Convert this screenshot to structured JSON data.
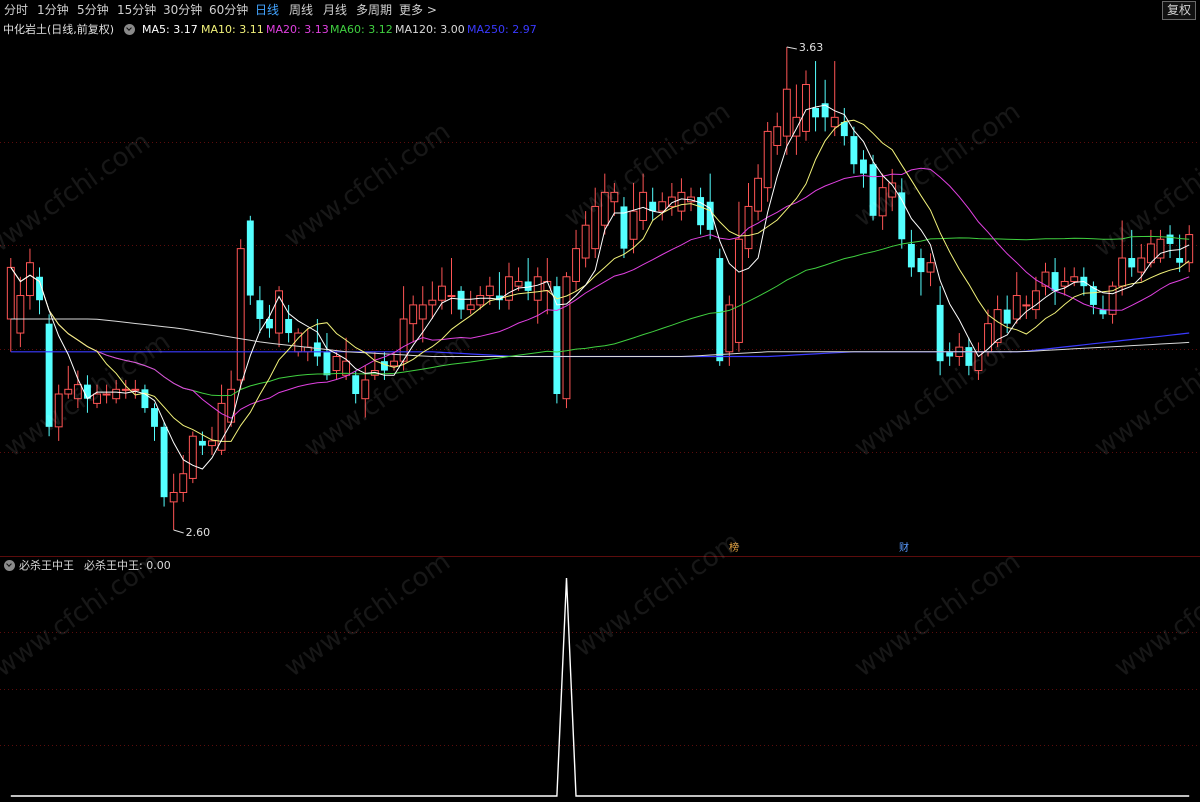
{
  "toolbar": {
    "tabs": [
      "分时",
      "1分钟",
      "5分钟",
      "15分钟",
      "30分钟",
      "60分钟",
      "日线",
      "周线",
      "月线",
      "多周期",
      "更多 >"
    ],
    "active_tab": "日线",
    "fq_label": "复权"
  },
  "stock": {
    "title": "中化岩土(日线,前复权)"
  },
  "ma_legend": [
    {
      "label": "MA5: 3.17",
      "color": "#ffffff"
    },
    {
      "label": "MA10: 3.11",
      "color": "#f2f27a"
    },
    {
      "label": "MA20: 3.13",
      "color": "#e040e0"
    },
    {
      "label": "MA60: 3.12",
      "color": "#40d040"
    },
    {
      "label": "MA120: 3.00",
      "color": "#d8d8d8"
    },
    {
      "label": "MA250: 2.97",
      "color": "#3a3aff"
    }
  ],
  "annotations": {
    "high_label": "3.63",
    "low_label": "2.60"
  },
  "badges": [
    {
      "text": "榜",
      "color": "#e0a040"
    },
    {
      "text": "财",
      "color": "#5a9aff"
    }
  ],
  "indicator": {
    "name": "必杀王中王",
    "value_label": "必杀王中王: 0.00"
  },
  "watermark_text": "www.cfchi.com",
  "colors": {
    "up": "#ff5555",
    "down": "#54ffff",
    "grid": "#5c0c0c",
    "active_tab": "#43a4ff"
  },
  "chart_data": {
    "type": "candlestick",
    "price_range": [
      2.6,
      3.63
    ],
    "candles": [
      {
        "o": 3.05,
        "c": 3.16,
        "h": 3.18,
        "l": 2.98
      },
      {
        "o": 3.02,
        "c": 3.1,
        "h": 3.14,
        "l": 2.99
      },
      {
        "o": 3.1,
        "c": 3.17,
        "h": 3.2,
        "l": 3.07
      },
      {
        "o": 3.14,
        "c": 3.09,
        "h": 3.16,
        "l": 3.06
      },
      {
        "o": 3.04,
        "c": 2.82,
        "h": 3.06,
        "l": 2.8
      },
      {
        "o": 2.82,
        "c": 2.89,
        "h": 2.91,
        "l": 2.79
      },
      {
        "o": 2.89,
        "c": 2.9,
        "h": 2.95,
        "l": 2.88
      },
      {
        "o": 2.88,
        "c": 2.91,
        "h": 2.94,
        "l": 2.86
      },
      {
        "o": 2.91,
        "c": 2.88,
        "h": 2.93,
        "l": 2.85
      },
      {
        "o": 2.87,
        "c": 2.89,
        "h": 2.91,
        "l": 2.86
      },
      {
        "o": 2.89,
        "c": 2.89,
        "h": 2.91,
        "l": 2.87
      },
      {
        "o": 2.88,
        "c": 2.9,
        "h": 2.92,
        "l": 2.87
      },
      {
        "o": 2.9,
        "c": 2.9,
        "h": 2.92,
        "l": 2.88
      },
      {
        "o": 2.9,
        "c": 2.9,
        "h": 2.92,
        "l": 2.88
      },
      {
        "o": 2.9,
        "c": 2.86,
        "h": 2.91,
        "l": 2.85
      },
      {
        "o": 2.86,
        "c": 2.82,
        "h": 2.87,
        "l": 2.79
      },
      {
        "o": 2.82,
        "c": 2.67,
        "h": 2.83,
        "l": 2.65
      },
      {
        "o": 2.66,
        "c": 2.68,
        "h": 2.72,
        "l": 2.6
      },
      {
        "o": 2.68,
        "c": 2.72,
        "h": 2.76,
        "l": 2.66
      },
      {
        "o": 2.71,
        "c": 2.8,
        "h": 2.81,
        "l": 2.7
      },
      {
        "o": 2.79,
        "c": 2.78,
        "h": 2.81,
        "l": 2.76
      },
      {
        "o": 2.78,
        "c": 2.79,
        "h": 2.82,
        "l": 2.76
      },
      {
        "o": 2.77,
        "c": 2.87,
        "h": 2.91,
        "l": 2.76
      },
      {
        "o": 2.83,
        "c": 2.9,
        "h": 2.94,
        "l": 2.82
      },
      {
        "o": 2.92,
        "c": 3.2,
        "h": 3.22,
        "l": 2.9
      },
      {
        "o": 3.26,
        "c": 3.1,
        "h": 3.27,
        "l": 3.08
      },
      {
        "o": 3.09,
        "c": 3.05,
        "h": 3.12,
        "l": 3.02
      },
      {
        "o": 3.05,
        "c": 3.03,
        "h": 3.08,
        "l": 3.01
      },
      {
        "o": 3.02,
        "c": 3.11,
        "h": 3.12,
        "l": 2.99
      },
      {
        "o": 3.05,
        "c": 3.02,
        "h": 3.08,
        "l": 3.0
      },
      {
        "o": 2.98,
        "c": 3.02,
        "h": 3.03,
        "l": 2.97
      },
      {
        "o": 2.98,
        "c": 2.99,
        "h": 3.03,
        "l": 2.96
      },
      {
        "o": 3.0,
        "c": 2.97,
        "h": 3.05,
        "l": 2.95
      },
      {
        "o": 2.98,
        "c": 2.93,
        "h": 3.02,
        "l": 2.92
      },
      {
        "o": 2.94,
        "c": 2.97,
        "h": 2.98,
        "l": 2.92
      },
      {
        "o": 2.93,
        "c": 2.96,
        "h": 3.01,
        "l": 2.92
      },
      {
        "o": 2.93,
        "c": 2.89,
        "h": 2.94,
        "l": 2.87
      },
      {
        "o": 2.88,
        "c": 2.92,
        "h": 2.95,
        "l": 2.84
      },
      {
        "o": 2.93,
        "c": 2.94,
        "h": 2.98,
        "l": 2.92
      },
      {
        "o": 2.96,
        "c": 2.94,
        "h": 2.98,
        "l": 2.92
      },
      {
        "o": 2.95,
        "c": 2.96,
        "h": 2.98,
        "l": 2.94
      },
      {
        "o": 2.96,
        "c": 3.05,
        "h": 3.12,
        "l": 2.94
      },
      {
        "o": 3.04,
        "c": 3.08,
        "h": 3.1,
        "l": 3.0
      },
      {
        "o": 3.05,
        "c": 3.08,
        "h": 3.12,
        "l": 3.0
      },
      {
        "o": 3.08,
        "c": 3.09,
        "h": 3.13,
        "l": 3.05
      },
      {
        "o": 3.09,
        "c": 3.12,
        "h": 3.16,
        "l": 3.07
      },
      {
        "o": 3.1,
        "c": 3.1,
        "h": 3.18,
        "l": 3.06
      },
      {
        "o": 3.11,
        "c": 3.07,
        "h": 3.12,
        "l": 3.05
      },
      {
        "o": 3.07,
        "c": 3.08,
        "h": 3.11,
        "l": 3.06
      },
      {
        "o": 3.08,
        "c": 3.1,
        "h": 3.12,
        "l": 3.07
      },
      {
        "o": 3.1,
        "c": 3.12,
        "h": 3.14,
        "l": 3.08
      },
      {
        "o": 3.1,
        "c": 3.09,
        "h": 3.15,
        "l": 3.07
      },
      {
        "o": 3.09,
        "c": 3.14,
        "h": 3.17,
        "l": 3.07
      },
      {
        "o": 3.12,
        "c": 3.13,
        "h": 3.16,
        "l": 3.11
      },
      {
        "o": 3.13,
        "c": 3.11,
        "h": 3.18,
        "l": 3.09
      },
      {
        "o": 3.09,
        "c": 3.14,
        "h": 3.16,
        "l": 3.04
      },
      {
        "o": 3.11,
        "c": 3.13,
        "h": 3.18,
        "l": 3.06
      },
      {
        "o": 3.12,
        "c": 2.89,
        "h": 3.14,
        "l": 2.87
      },
      {
        "o": 2.88,
        "c": 3.14,
        "h": 3.15,
        "l": 2.86
      },
      {
        "o": 3.13,
        "c": 3.2,
        "h": 3.24,
        "l": 3.11
      },
      {
        "o": 3.18,
        "c": 3.25,
        "h": 3.28,
        "l": 3.16
      },
      {
        "o": 3.2,
        "c": 3.29,
        "h": 3.33,
        "l": 3.18
      },
      {
        "o": 3.25,
        "c": 3.32,
        "h": 3.36,
        "l": 3.23
      },
      {
        "o": 3.3,
        "c": 3.32,
        "h": 3.34,
        "l": 3.27
      },
      {
        "o": 3.29,
        "c": 3.2,
        "h": 3.31,
        "l": 3.18
      },
      {
        "o": 3.22,
        "c": 3.28,
        "h": 3.34,
        "l": 3.19
      },
      {
        "o": 3.26,
        "c": 3.32,
        "h": 3.36,
        "l": 3.24
      },
      {
        "o": 3.3,
        "c": 3.28,
        "h": 3.33,
        "l": 3.26
      },
      {
        "o": 3.28,
        "c": 3.3,
        "h": 3.32,
        "l": 3.26
      },
      {
        "o": 3.29,
        "c": 3.31,
        "h": 3.34,
        "l": 3.27
      },
      {
        "o": 3.28,
        "c": 3.32,
        "h": 3.35,
        "l": 3.26
      },
      {
        "o": 3.3,
        "c": 3.31,
        "h": 3.33,
        "l": 3.28
      },
      {
        "o": 3.31,
        "c": 3.25,
        "h": 3.33,
        "l": 3.23
      },
      {
        "o": 3.3,
        "c": 3.24,
        "h": 3.36,
        "l": 3.22
      },
      {
        "o": 3.18,
        "c": 2.96,
        "h": 3.2,
        "l": 2.95
      },
      {
        "o": 2.98,
        "c": 3.08,
        "h": 3.1,
        "l": 2.95
      },
      {
        "o": 3.0,
        "c": 3.22,
        "h": 3.3,
        "l": 2.98
      },
      {
        "o": 3.2,
        "c": 3.29,
        "h": 3.34,
        "l": 3.18
      },
      {
        "o": 3.28,
        "c": 3.35,
        "h": 3.38,
        "l": 3.26
      },
      {
        "o": 3.33,
        "c": 3.45,
        "h": 3.47,
        "l": 3.3
      },
      {
        "o": 3.42,
        "c": 3.46,
        "h": 3.49,
        "l": 3.4
      },
      {
        "o": 3.44,
        "c": 3.54,
        "h": 3.63,
        "l": 3.4
      },
      {
        "o": 3.44,
        "c": 3.48,
        "h": 3.55,
        "l": 3.4
      },
      {
        "o": 3.45,
        "c": 3.55,
        "h": 3.58,
        "l": 3.43
      },
      {
        "o": 3.5,
        "c": 3.48,
        "h": 3.6,
        "l": 3.45
      },
      {
        "o": 3.51,
        "c": 3.48,
        "h": 3.56,
        "l": 3.45
      },
      {
        "o": 3.46,
        "c": 3.48,
        "h": 3.6,
        "l": 3.44
      },
      {
        "o": 3.47,
        "c": 3.44,
        "h": 3.5,
        "l": 3.42
      },
      {
        "o": 3.44,
        "c": 3.38,
        "h": 3.46,
        "l": 3.36
      },
      {
        "o": 3.39,
        "c": 3.36,
        "h": 3.41,
        "l": 3.33
      },
      {
        "o": 3.38,
        "c": 3.27,
        "h": 3.4,
        "l": 3.26
      },
      {
        "o": 3.27,
        "c": 3.33,
        "h": 3.36,
        "l": 3.24
      },
      {
        "o": 3.31,
        "c": 3.34,
        "h": 3.37,
        "l": 3.28
      },
      {
        "o": 3.32,
        "c": 3.22,
        "h": 3.35,
        "l": 3.2
      },
      {
        "o": 3.21,
        "c": 3.16,
        "h": 3.24,
        "l": 3.14
      },
      {
        "o": 3.18,
        "c": 3.15,
        "h": 3.2,
        "l": 3.1
      },
      {
        "o": 3.15,
        "c": 3.17,
        "h": 3.19,
        "l": 3.12
      },
      {
        "o": 3.08,
        "c": 2.96,
        "h": 3.12,
        "l": 2.93
      },
      {
        "o": 2.98,
        "c": 2.97,
        "h": 3.0,
        "l": 2.95
      },
      {
        "o": 2.97,
        "c": 2.99,
        "h": 3.02,
        "l": 2.95
      },
      {
        "o": 2.99,
        "c": 2.95,
        "h": 3.01,
        "l": 2.93
      },
      {
        "o": 2.94,
        "c": 2.98,
        "h": 3.0,
        "l": 2.92
      },
      {
        "o": 2.98,
        "c": 3.04,
        "h": 3.07,
        "l": 2.97
      },
      {
        "o": 3.0,
        "c": 3.07,
        "h": 3.1,
        "l": 2.99
      },
      {
        "o": 3.07,
        "c": 3.04,
        "h": 3.1,
        "l": 3.02
      },
      {
        "o": 3.05,
        "c": 3.1,
        "h": 3.15,
        "l": 3.04
      },
      {
        "o": 3.08,
        "c": 3.08,
        "h": 3.1,
        "l": 3.05
      },
      {
        "o": 3.07,
        "c": 3.11,
        "h": 3.14,
        "l": 3.05
      },
      {
        "o": 3.12,
        "c": 3.15,
        "h": 3.17,
        "l": 3.1
      },
      {
        "o": 3.15,
        "c": 3.11,
        "h": 3.18,
        "l": 3.08
      },
      {
        "o": 3.12,
        "c": 3.13,
        "h": 3.16,
        "l": 3.1
      },
      {
        "o": 3.13,
        "c": 3.14,
        "h": 3.16,
        "l": 3.12
      },
      {
        "o": 3.14,
        "c": 3.12,
        "h": 3.16,
        "l": 3.1
      },
      {
        "o": 3.12,
        "c": 3.08,
        "h": 3.13,
        "l": 3.06
      },
      {
        "o": 3.07,
        "c": 3.06,
        "h": 3.1,
        "l": 3.05
      },
      {
        "o": 3.06,
        "c": 3.12,
        "h": 3.13,
        "l": 3.04
      },
      {
        "o": 3.12,
        "c": 3.18,
        "h": 3.26,
        "l": 3.1
      },
      {
        "o": 3.18,
        "c": 3.16,
        "h": 3.24,
        "l": 3.14
      },
      {
        "o": 3.15,
        "c": 3.18,
        "h": 3.21,
        "l": 3.13
      },
      {
        "o": 3.17,
        "c": 3.21,
        "h": 3.24,
        "l": 3.16
      },
      {
        "o": 3.18,
        "c": 3.22,
        "h": 3.24,
        "l": 3.17
      },
      {
        "o": 3.23,
        "c": 3.21,
        "h": 3.25,
        "l": 3.18
      },
      {
        "o": 3.18,
        "c": 3.17,
        "h": 3.23,
        "l": 3.15
      },
      {
        "o": 3.17,
        "c": 3.23,
        "h": 3.25,
        "l": 3.15
      }
    ],
    "ma250": [
      2.98,
      2.98,
      2.98,
      2.98,
      2.98,
      2.98,
      2.97,
      2.97,
      2.97,
      2.97,
      2.98,
      2.98,
      2.98,
      3.0,
      3.02
    ],
    "ma120": [
      3.05,
      3.05,
      3.03,
      3.0,
      2.98,
      2.97,
      2.97,
      2.97,
      2.97,
      2.98,
      2.98,
      2.98,
      2.98,
      2.99,
      3.0
    ],
    "indicator_values": [
      0,
      0,
      0,
      0,
      0,
      0,
      0,
      0,
      0,
      0,
      0,
      0,
      0,
      0,
      0,
      0,
      0,
      0,
      0,
      0,
      0,
      0,
      0,
      0,
      0,
      0,
      0,
      0,
      0,
      0,
      0,
      0,
      0,
      0,
      0,
      0,
      0,
      0,
      0,
      0,
      0,
      0,
      0,
      0,
      0,
      0,
      0,
      0,
      0,
      0,
      0,
      0,
      0,
      0,
      0,
      0,
      0,
      0,
      1,
      0,
      0,
      0,
      0,
      0,
      0,
      0,
      0,
      0,
      0,
      0,
      0,
      0,
      0,
      0,
      0,
      0,
      0,
      0,
      0,
      0,
      0,
      0,
      0,
      0,
      0,
      0,
      0,
      0,
      0,
      0,
      0,
      0,
      0,
      0,
      0,
      0,
      0,
      0,
      0,
      0,
      0,
      0,
      0,
      0,
      0,
      0,
      0,
      0,
      0,
      0,
      0,
      0,
      0,
      0,
      0,
      0,
      0,
      0,
      0,
      0,
      0,
      0,
      0,
      0
    ]
  }
}
